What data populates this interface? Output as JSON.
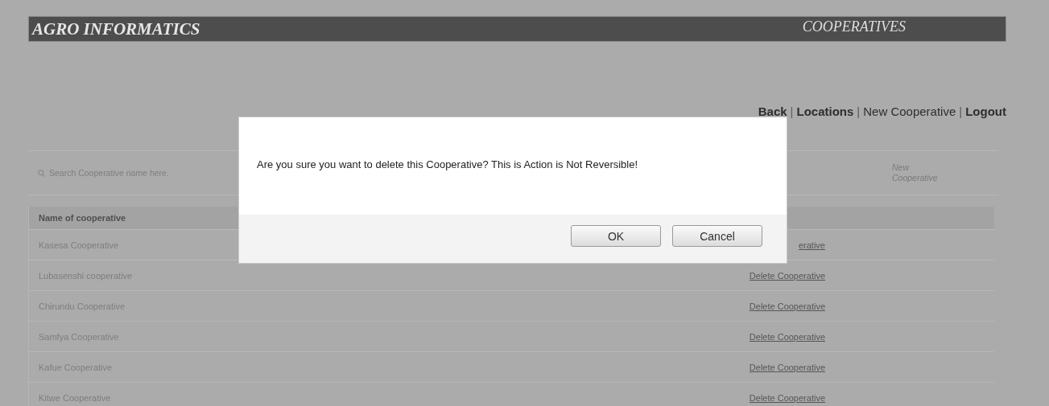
{
  "header": {
    "title": "AGRO INFORMATICS",
    "section": "COOPERATIVES"
  },
  "nav": [
    {
      "kind": "link",
      "label": "Back",
      "bold": true
    },
    {
      "kind": "separator",
      "label": "|",
      "bold": false
    },
    {
      "kind": "link",
      "label": "Locations",
      "bold": true
    },
    {
      "kind": "separator",
      "label": "|",
      "bold": false
    },
    {
      "kind": "link",
      "label": "New Cooperative",
      "bold": false
    },
    {
      "kind": "separator",
      "label": "|",
      "bold": false
    },
    {
      "kind": "link",
      "label": "Logout",
      "bold": true
    }
  ],
  "search": {
    "placeholder": "Search Cooperative name here."
  },
  "new_link": "New Cooperative",
  "table": {
    "columns": [
      "Name of cooperative"
    ],
    "rows": [
      {
        "name": "Kasesa Cooperative",
        "action": "erative"
      },
      {
        "name": "Lubasenshi cooperative",
        "action": "Delete Cooperative"
      },
      {
        "name": "Chirundu Cooperative",
        "action": "Delete Cooperative"
      },
      {
        "name": "Samfya Cooperative",
        "action": "Delete Cooperative"
      },
      {
        "name": "Kafue Cooperative",
        "action": "Delete Cooperative"
      },
      {
        "name": "Kitwe Cooperative",
        "action": "Delete Cooperative"
      }
    ]
  },
  "dialog": {
    "message": "Are you sure you want to delete this Cooperative? This is Action is Not Reversible!",
    "buttons": [
      "OK",
      "Cancel"
    ]
  }
}
